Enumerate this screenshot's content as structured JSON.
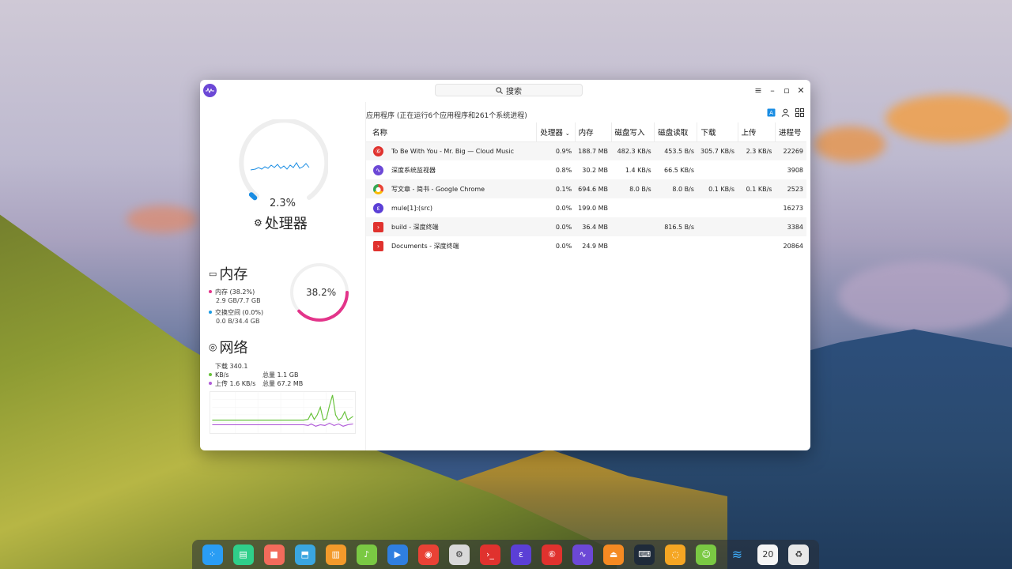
{
  "window": {
    "search_placeholder": "搜索",
    "subtitle": "应用程序 (正在运行6个应用程序和261个系统进程)"
  },
  "cpu": {
    "percent": "2.3%",
    "label": "处理器",
    "usage_fraction": 0.023
  },
  "memory": {
    "title": "内存",
    "percent": "38.2%",
    "usage_fraction": 0.382,
    "mem_label": "内存 (38.2%)",
    "mem_detail": "2.9 GB/7.7 GB",
    "swap_label": "交换空间 (0.0%)",
    "swap_detail": "0.0 B/34.4 GB",
    "colors": {
      "mem": "#e3348a",
      "swap": "#1a9be3"
    }
  },
  "network": {
    "title": "网络",
    "download_label": "下载 340.1 KB/s",
    "download_total": "总量 1.1 GB",
    "upload_label": "上传 1.6 KB/s",
    "upload_total": "总量 67.2 MB",
    "colors": {
      "download": "#67c23a",
      "upload": "#b05cd8"
    }
  },
  "table": {
    "columns": [
      "名称",
      "处理器",
      "内存",
      "磁盘写入",
      "磁盘读取",
      "下载",
      "上传",
      "进程号"
    ],
    "rows": [
      {
        "icon": "netease-music-icon",
        "name": "To Be With You - Mr. Big — Cloud Music",
        "cpu": "0.9%",
        "mem": "188.7 MB",
        "disk_write": "482.3 KB/s",
        "disk_read": "453.5 B/s",
        "download": "305.7 KB/s",
        "upload": "2.3 KB/s",
        "pid": "22269"
      },
      {
        "icon": "system-monitor-icon",
        "name": "深度系统监视器",
        "cpu": "0.8%",
        "mem": "30.2 MB",
        "disk_write": "1.4 KB/s",
        "disk_read": "66.5 KB/s",
        "download": "",
        "upload": "",
        "pid": "3908"
      },
      {
        "icon": "chrome-icon",
        "name": "写文章 - 简书 - Google Chrome",
        "cpu": "0.1%",
        "mem": "694.6 MB",
        "disk_write": "8.0 B/s",
        "disk_read": "8.0 B/s",
        "download": "0.1 KB/s",
        "upload": "0.1 KB/s",
        "pid": "2523"
      },
      {
        "icon": "mule-icon",
        "name": "mule[1]:(src)",
        "cpu": "0.0%",
        "mem": "199.0 MB",
        "disk_write": "",
        "disk_read": "",
        "download": "",
        "upload": "",
        "pid": "16273"
      },
      {
        "icon": "terminal-icon",
        "name": "build - 深度终端",
        "cpu": "0.0%",
        "mem": "36.4 MB",
        "disk_write": "",
        "disk_read": "816.5 B/s",
        "download": "",
        "upload": "",
        "pid": "3384"
      },
      {
        "icon": "terminal-icon",
        "name": "Documents - 深度终端",
        "cpu": "0.0%",
        "mem": "24.9 MB",
        "disk_write": "",
        "disk_read": "",
        "download": "",
        "upload": "",
        "pid": "20864"
      }
    ]
  },
  "dock": {
    "items": [
      "launcher-icon",
      "file-manager-icon",
      "screen-recorder-icon",
      "app-store-icon",
      "archive-manager-icon",
      "music-icon",
      "movie-icon",
      "chrome-icon",
      "settings-icon",
      "terminal-icon",
      "draw-icon",
      "netease-music-icon",
      "system-monitor-icon",
      "uploader-icon",
      "keyboard-icon",
      "browser-icon",
      "android-icon",
      "wifi-icon",
      "calendar-icon",
      "trash-icon"
    ]
  }
}
